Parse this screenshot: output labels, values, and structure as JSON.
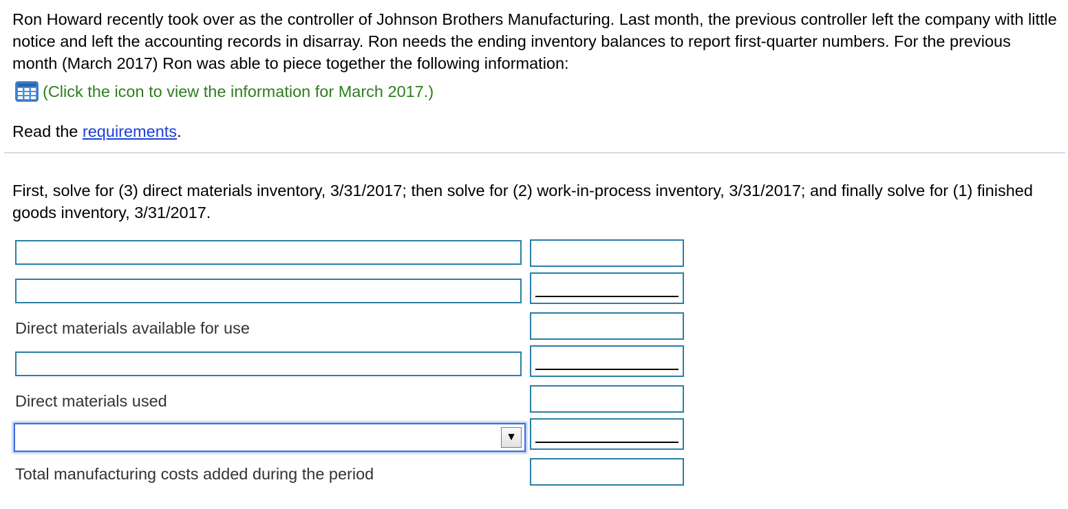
{
  "intro": {
    "text": "Ron Howard recently took over as the controller of Johnson Brothers Manufacturing. Last month, the previous controller left the company with little notice and left the accounting records in disarray. Ron needs the ending inventory balances to report first-quarter numbers. For the previous month (March 2017) Ron was able to piece together the following information:"
  },
  "info_link": {
    "icon": "table-grid-icon",
    "text": "(Click the icon to view the information for March 2017.)",
    "color": "#2e7d1e"
  },
  "requirements": {
    "prefix": "Read the ",
    "link_text": "requirements",
    "suffix": ".",
    "link_color": "#1a3fd6"
  },
  "instructions": {
    "text": "First, solve for (3) direct materials inventory, 3/31/2017; then solve for (2) work-in-process inventory, 3/31/2017; and finally solve for (1) finished goods inventory, 3/31/2017."
  },
  "schedule": {
    "row1": {
      "label_value": "",
      "amount_value": ""
    },
    "row2": {
      "label_value": "",
      "amount_value": ""
    },
    "row3": {
      "label": "Direct materials available for use",
      "amount_value": ""
    },
    "row4": {
      "label_value": "",
      "amount_value": ""
    },
    "row5": {
      "label": "Direct materials used",
      "amount_value": ""
    },
    "row6": {
      "selected_value": "",
      "arrow": "▼",
      "amount_value": ""
    },
    "row7": {
      "label": "Total manufacturing costs added during the period",
      "amount_value": ""
    }
  }
}
